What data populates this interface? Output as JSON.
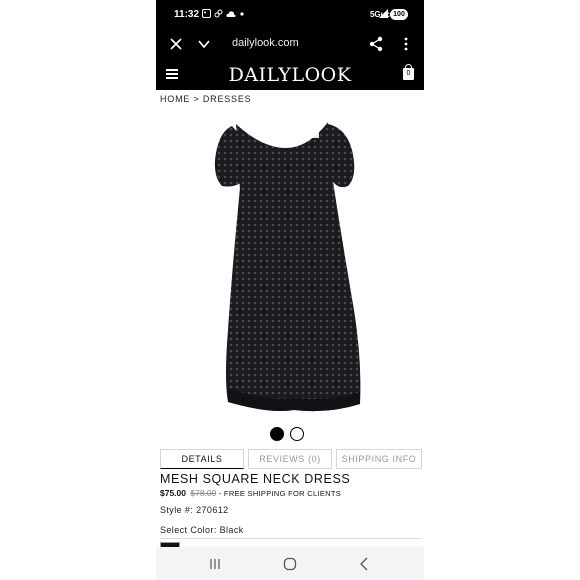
{
  "status": {
    "time": "11:32",
    "network": "5Guc",
    "battery": "100"
  },
  "browser": {
    "url": "dailylook.com"
  },
  "site": {
    "logo": "DAILYLOOK",
    "cart_count": "0"
  },
  "breadcrumb": "HOME > DRESSES",
  "product": {
    "tabs": [
      {
        "label": "DETAILS"
      },
      {
        "label": "REVIEWS (0)"
      },
      {
        "label": "SHIPPING INFO"
      }
    ],
    "name": "MESH SQUARE NECK DRESS",
    "price": "$75.00",
    "original_price": "$78.00",
    "shipping_note": "- FREE SHIPPING FOR CLIENTS",
    "style_number": "Style #: 270612",
    "select_color": "Select Color: Black"
  },
  "icons": {
    "status": [
      "image-icon",
      "link-icon",
      "cloud-icon",
      "dot-icon",
      "signal-icon",
      "battery-icon"
    ],
    "browser": [
      "close-icon",
      "chevron-down-icon",
      "share-icon",
      "more-vert-icon"
    ],
    "header": [
      "hamburger-icon",
      "bag-icon"
    ],
    "navbar": [
      "recent-apps-icon",
      "home-icon",
      "back-icon"
    ]
  },
  "colors": {
    "header_bg": "#000000",
    "dress": "#1b1a1f",
    "swatch_black": "#111111"
  }
}
